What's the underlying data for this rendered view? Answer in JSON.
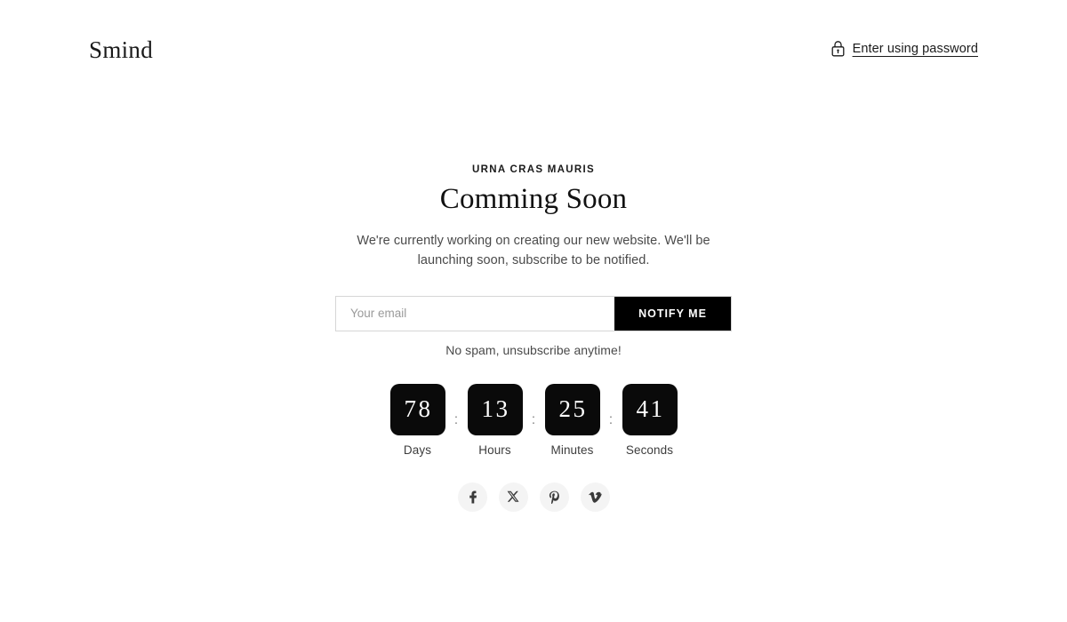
{
  "header": {
    "brand": "Smind",
    "lock_icon": "lock-icon",
    "password_link": "Enter using password"
  },
  "main": {
    "eyebrow": "URNA CRAS MAURIS",
    "title": "Comming Soon",
    "description": "We're currently working on creating our new website. We'll be launching soon, subscribe to be notified.",
    "form": {
      "email_value": "",
      "email_placeholder": "Your email",
      "submit_label": "NOTIFY ME"
    },
    "spam_note": "No spam, unsubscribe anytime!",
    "countdown": {
      "separator": ":",
      "units": [
        {
          "value": "78",
          "label": "Days"
        },
        {
          "value": "13",
          "label": "Hours"
        },
        {
          "value": "25",
          "label": "Minutes"
        },
        {
          "value": "41",
          "label": "Seconds"
        }
      ]
    },
    "social": [
      {
        "name": "facebook",
        "glyph": "facebook-icon"
      },
      {
        "name": "x-twitter",
        "glyph": "x-icon"
      },
      {
        "name": "pinterest",
        "glyph": "pinterest-icon"
      },
      {
        "name": "vimeo",
        "glyph": "vimeo-icon"
      }
    ]
  },
  "colors": {
    "background": "#ffffff",
    "text": "#1a1a1a",
    "muted": "#4a4a4a",
    "accent": "#000000",
    "social_bg": "#f4f4f4",
    "border": "#d6d6d6"
  }
}
